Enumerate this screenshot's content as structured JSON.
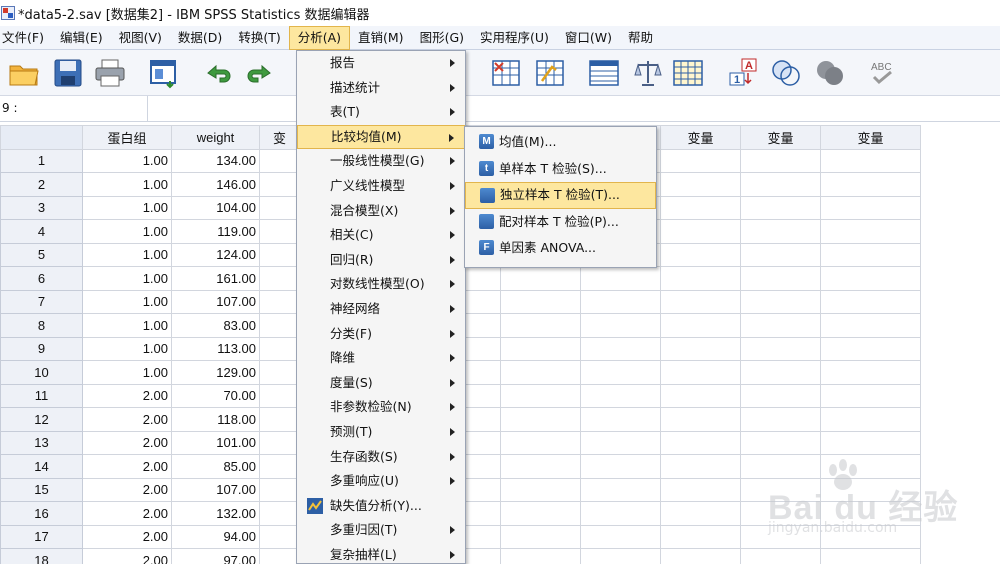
{
  "window": {
    "title": "*data5-2.sav [数据集2] - IBM SPSS Statistics 数据编辑器"
  },
  "menubar": {
    "items": [
      "文件(F)",
      "编辑(E)",
      "视图(V)",
      "数据(D)",
      "转换(T)",
      "分析(A)",
      "直销(M)",
      "图形(G)",
      "实用程序(U)",
      "窗口(W)",
      "帮助"
    ],
    "active_index": 5
  },
  "toolbar": {
    "icons": [
      "open-folder-icon",
      "save-icon",
      "print-icon",
      "dialog-recall-icon",
      "undo-icon",
      "redo-icon",
      "go-to-case-icon",
      "variables-icon",
      "split-file-icon",
      "weight-cases-icon",
      "value-labels-icon",
      "use-variable-sets-icon",
      "show-all-variables-icon",
      "spell-check-icon"
    ]
  },
  "cell_editor": {
    "cell_ref": "9 :",
    "value": ""
  },
  "grid": {
    "columns": [
      "蛋白组",
      "weight",
      "变",
      "",
      "",
      "",
      "",
      "变量",
      "变量",
      "变量",
      "变量",
      "变量"
    ],
    "rows": [
      [
        "1.00",
        "134.00"
      ],
      [
        "1.00",
        "146.00"
      ],
      [
        "1.00",
        "104.00"
      ],
      [
        "1.00",
        "119.00"
      ],
      [
        "1.00",
        "124.00"
      ],
      [
        "1.00",
        "161.00"
      ],
      [
        "1.00",
        "107.00"
      ],
      [
        "1.00",
        "83.00"
      ],
      [
        "1.00",
        "113.00"
      ],
      [
        "1.00",
        "129.00"
      ],
      [
        "2.00",
        "70.00"
      ],
      [
        "2.00",
        "118.00"
      ],
      [
        "2.00",
        "101.00"
      ],
      [
        "2.00",
        "85.00"
      ],
      [
        "2.00",
        "107.00"
      ],
      [
        "2.00",
        "132.00"
      ],
      [
        "2.00",
        "94.00"
      ],
      [
        "2.00",
        "97.00"
      ]
    ],
    "row_numbers": [
      "1",
      "2",
      "3",
      "4",
      "5",
      "6",
      "7",
      "8",
      "9",
      "10",
      "11",
      "12",
      "13",
      "14",
      "15",
      "16",
      "17",
      "18"
    ],
    "selected_row": 9
  },
  "analyze_menu": {
    "items": [
      {
        "label": "报告",
        "submenu": true
      },
      {
        "label": "描述统计",
        "submenu": true
      },
      {
        "label": "表(T)",
        "submenu": true
      },
      {
        "label": "比较均值(M)",
        "submenu": true,
        "highlighted": true
      },
      {
        "label": "一般线性模型(G)",
        "submenu": true
      },
      {
        "label": "广义线性模型",
        "submenu": true
      },
      {
        "label": "混合模型(X)",
        "submenu": true
      },
      {
        "label": "相关(C)",
        "submenu": true
      },
      {
        "label": "回归(R)",
        "submenu": true
      },
      {
        "label": "对数线性模型(O)",
        "submenu": true
      },
      {
        "label": "神经网络",
        "submenu": true
      },
      {
        "label": "分类(F)",
        "submenu": true
      },
      {
        "label": "降维",
        "submenu": true
      },
      {
        "label": "度量(S)",
        "submenu": true
      },
      {
        "label": "非参数检验(N)",
        "submenu": true
      },
      {
        "label": "预测(T)",
        "submenu": true
      },
      {
        "label": "生存函数(S)",
        "submenu": true
      },
      {
        "label": "多重响应(U)",
        "submenu": true
      },
      {
        "label": "缺失值分析(Y)...",
        "submenu": false,
        "icon": "missing-value-icon"
      },
      {
        "label": "多重归因(T)",
        "submenu": true
      },
      {
        "label": "复杂抽样(L)",
        "submenu": true
      }
    ]
  },
  "compare_means_menu": {
    "items": [
      {
        "label": "均值(M)...",
        "icon_glyph": "M"
      },
      {
        "label": "单样本 T 检验(S)...",
        "icon_glyph": "t"
      },
      {
        "label": "独立样本 T 检验(T)...",
        "icon_glyph": "",
        "highlighted": true
      },
      {
        "label": "配对样本 T 检验(P)...",
        "icon_glyph": ""
      },
      {
        "label": "单因素 ANOVA...",
        "icon_glyph": "F"
      }
    ]
  },
  "watermark": {
    "brand": "Bai du 经验",
    "url": "jingyan.baidu.com"
  },
  "colors": {
    "highlight": "#fde79f",
    "highlight_border": "#e2b54c",
    "header_bg": "#eef1f7"
  }
}
